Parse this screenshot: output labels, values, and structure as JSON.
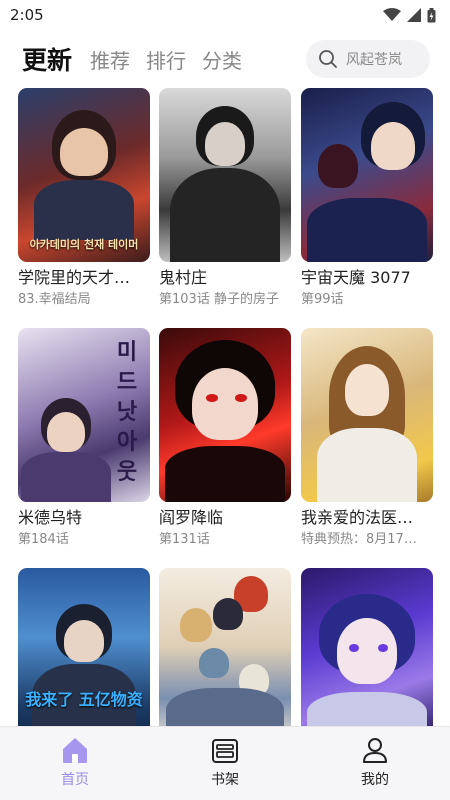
{
  "status": {
    "time": "2:05"
  },
  "tabs": [
    {
      "label": "更新",
      "active": true
    },
    {
      "label": "推荐",
      "active": false
    },
    {
      "label": "排行",
      "active": false
    },
    {
      "label": "分类",
      "active": false
    }
  ],
  "search": {
    "placeholder": "风起苍岚",
    "icon": "search-icon"
  },
  "comics": [
    {
      "title": "学院里的天才…",
      "subtitle": "83.幸福结局",
      "cover_text": "아카데미의 천재 테이머"
    },
    {
      "title": "鬼村庄",
      "subtitle": "第103话 静子的房子"
    },
    {
      "title": "宇宙天魔 3077",
      "subtitle": "第99话"
    },
    {
      "title": "米德乌特",
      "subtitle": "第184话",
      "cover_text": "미드 낫 아웃"
    },
    {
      "title": "阎罗降临",
      "subtitle": "第131话"
    },
    {
      "title": "我亲爱的法医…",
      "subtitle": "特典预热：8月17…"
    },
    {
      "title": "",
      "subtitle": "",
      "cover_text": "我来了 五亿物资"
    },
    {
      "title": "",
      "subtitle": ""
    },
    {
      "title": "",
      "subtitle": ""
    }
  ],
  "nav": [
    {
      "label": "首页",
      "icon": "home-icon",
      "active": true
    },
    {
      "label": "书架",
      "icon": "bookshelf-icon",
      "active": false
    },
    {
      "label": "我的",
      "icon": "profile-icon",
      "active": false
    }
  ],
  "colors": {
    "accent": "#9b8ae6",
    "active_tab": "#111111",
    "inactive_tab": "#888888"
  }
}
